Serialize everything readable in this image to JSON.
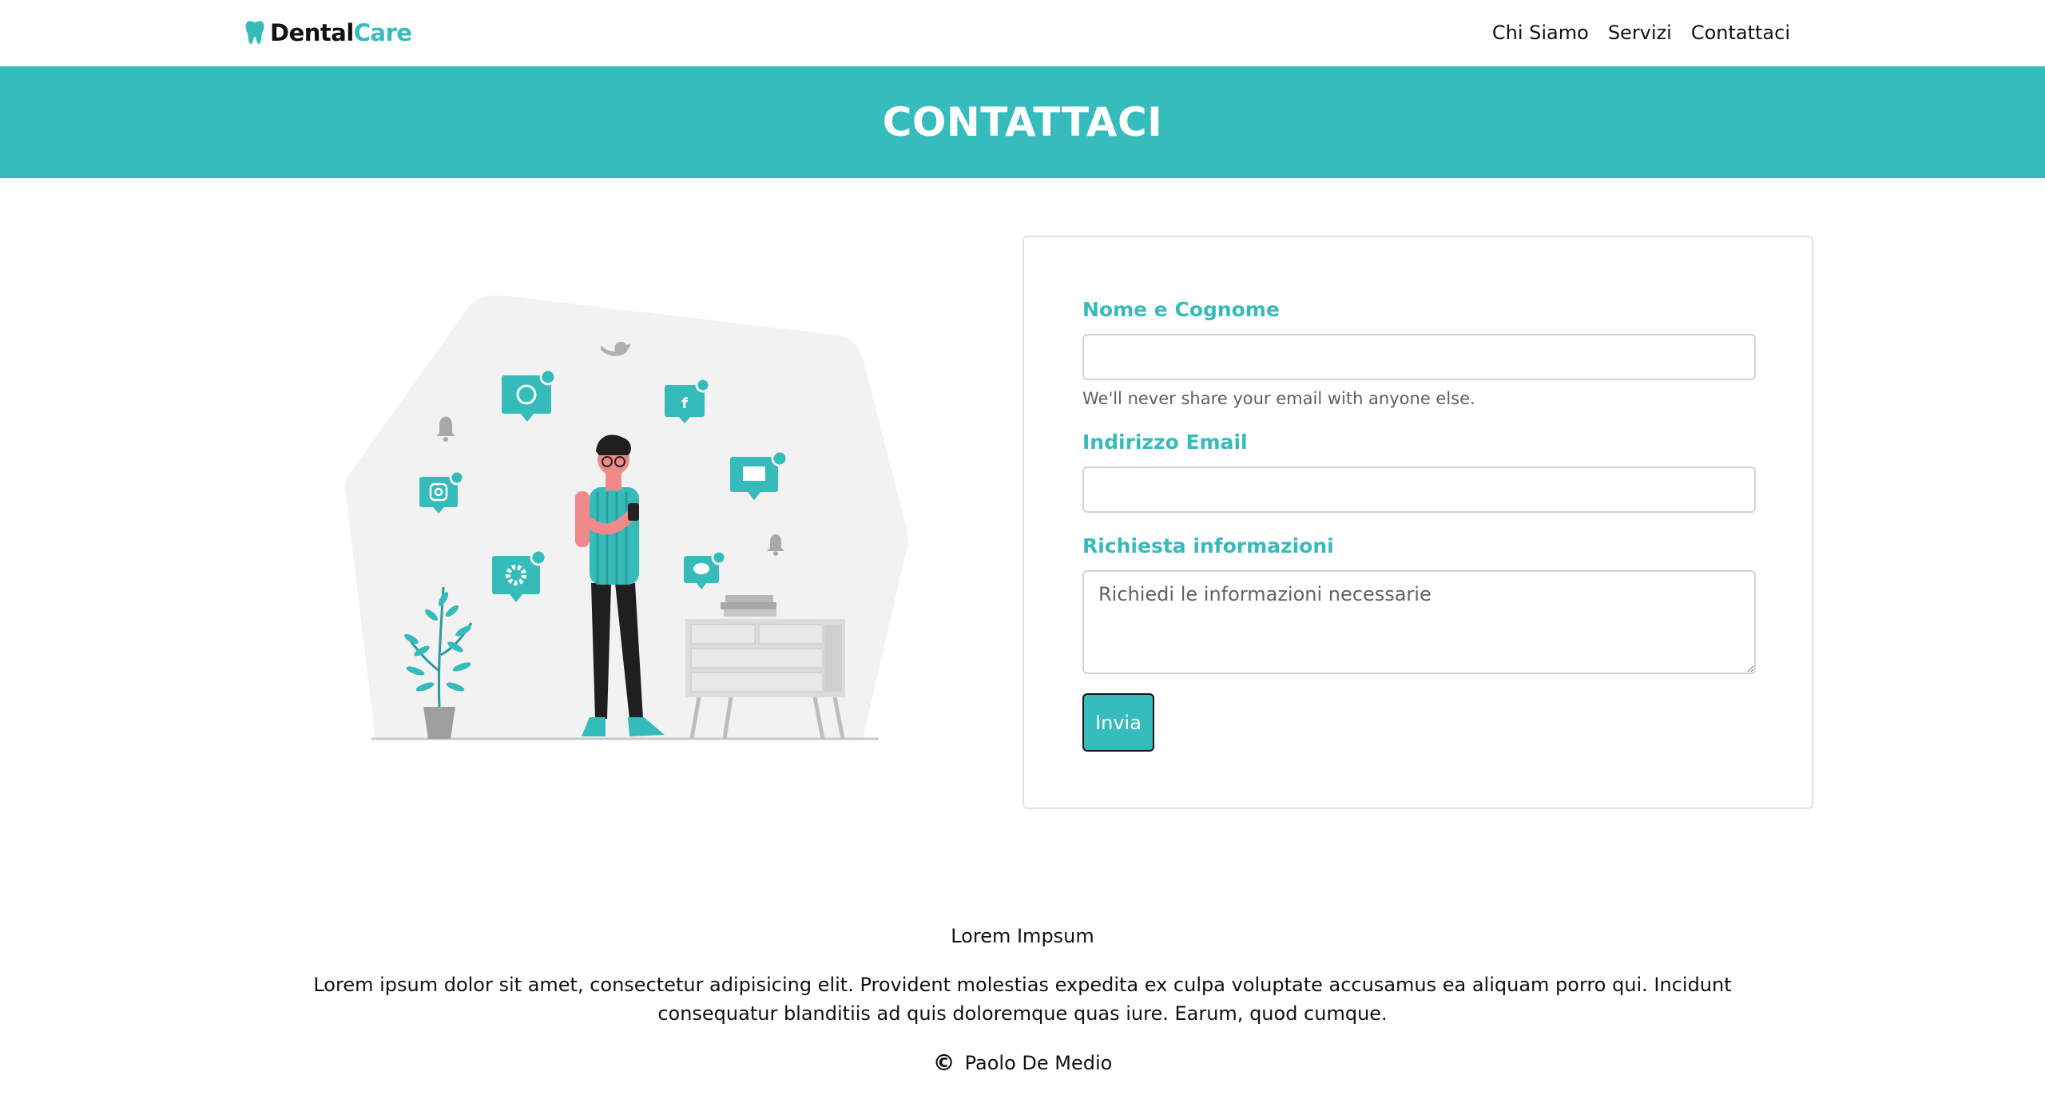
{
  "brand": {
    "part1": "Dental",
    "part2": "Care",
    "icon": "tooth-icon",
    "accent": "#36bbbb"
  },
  "nav": {
    "items": [
      "Chi Siamo",
      "Servizi",
      "Contattaci"
    ]
  },
  "hero": {
    "title": "CONTATTACI",
    "background": "#36bcbd"
  },
  "illustration": {
    "icons": [
      "whatsapp-icon",
      "twitter-icon",
      "facebook-icon",
      "bell-icon",
      "instagram-icon",
      "message-icon",
      "gear-icon",
      "chat-icon"
    ]
  },
  "form": {
    "name_label": "Nome e Cognome",
    "name_value": "",
    "name_help": "We'll never share your email with anyone else.",
    "email_label": "Indirizzo Email",
    "email_value": "",
    "request_label": "Richiesta informazioni",
    "request_placeholder": "Richiedi le informazioni necessarie",
    "submit_label": "Invia"
  },
  "footer": {
    "title": "Lorem Impsum",
    "text": "Lorem ipsum dolor sit amet, consectetur adipisicing elit. Provident molestias expedita ex culpa voluptate accusamus ea aliquam porro qui. Incidunt consequatur blanditiis ad quis doloremque quas iure. Earum, quod cumque.",
    "copyright_icon": "copyright-icon",
    "copyright_symbol": "©",
    "author": "Paolo De Medio"
  }
}
